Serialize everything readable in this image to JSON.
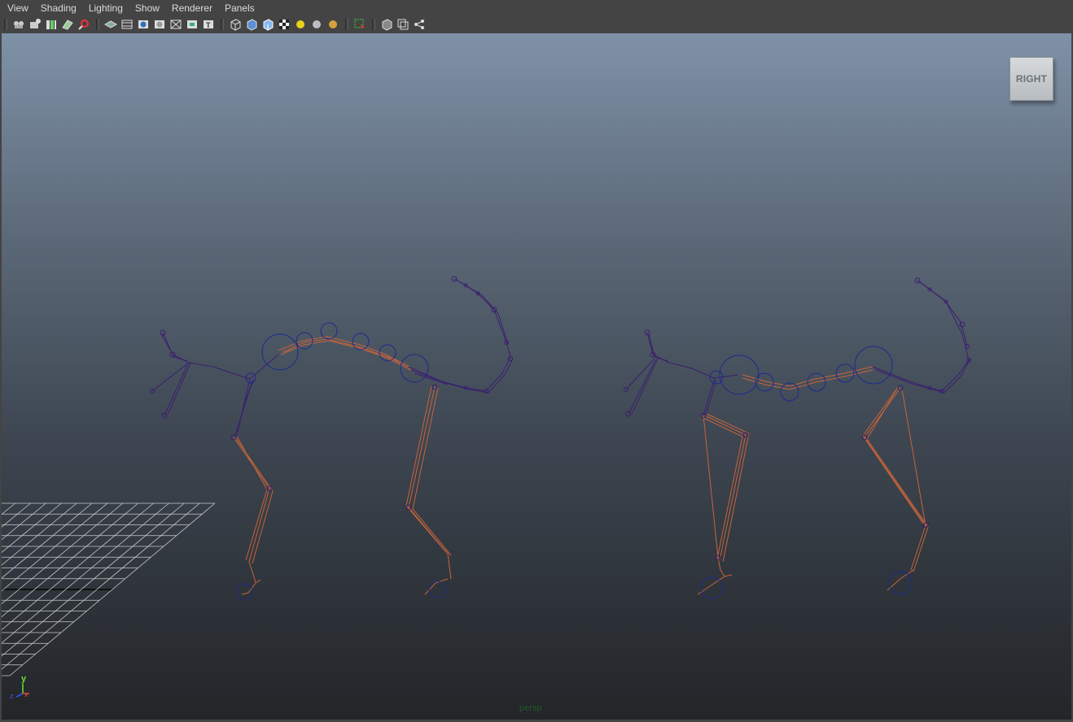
{
  "menu": [
    "View",
    "Shading",
    "Lighting",
    "Show",
    "Renderer",
    "Panels"
  ],
  "toolbar_icons": [
    "camera-select-icon",
    "camera-attributes-icon",
    "bookmark-icon",
    "image-plane-icon",
    "2d-pan-zoom-icon",
    "|",
    "grid-icon",
    "film-gate-icon",
    "resolution-gate-icon",
    "gate-mask-icon",
    "field-chart-icon",
    "safe-action-icon",
    "safe-title-icon",
    "|",
    "wireframe-icon",
    "smooth-shade-icon",
    "wireframe-on-shaded-icon",
    "textured-icon",
    "use-all-lights-icon",
    "shadows-icon",
    "screen-space-ao-icon",
    "|",
    "isolate-select-icon",
    "|",
    "xray-icon",
    "xray-joints-icon",
    "xray-components-icon"
  ],
  "viewcube": {
    "label": "RIGHT"
  },
  "camera_label": "persp",
  "axis": {
    "y_label": "y"
  },
  "colors": {
    "joint": "#3b1f6e",
    "bone": "#c8643a",
    "control": "#1d2a8c",
    "grid": "#c9c9c9"
  }
}
